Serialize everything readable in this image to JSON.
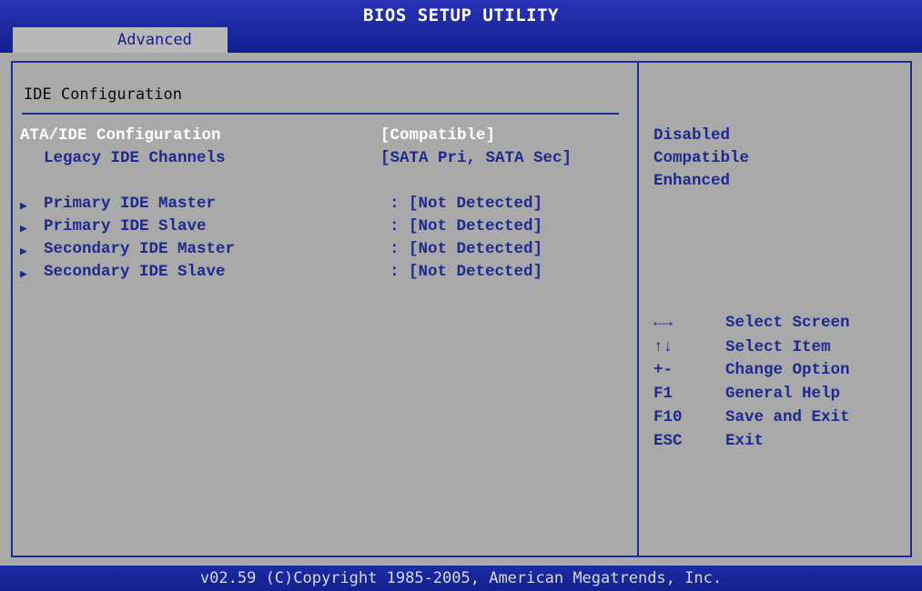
{
  "header": {
    "title": "BIOS SETUP UTILITY",
    "tab": "Advanced"
  },
  "section": {
    "title": "IDE Configuration"
  },
  "settings": [
    {
      "label": "ATA/IDE Configuration",
      "value": "[Compatible]",
      "selected": true
    },
    {
      "label": "Legacy IDE Channels",
      "value": "[SATA Pri, SATA Sec]"
    }
  ],
  "devices": [
    {
      "label": "Primary IDE Master",
      "value": ": [Not Detected]"
    },
    {
      "label": "Primary IDE Slave",
      "value": ": [Not Detected]"
    },
    {
      "label": "Secondary IDE Master",
      "value": ": [Not Detected]"
    },
    {
      "label": "Secondary IDE Slave",
      "value": ": [Not Detected]"
    }
  ],
  "submenu_arrow": "▶",
  "options": [
    "Disabled",
    "Compatible",
    "Enhanced"
  ],
  "help": [
    {
      "key": "←→",
      "desc": "Select Screen"
    },
    {
      "key": "↑↓",
      "desc": "Select Item"
    },
    {
      "key": "+-",
      "desc": "Change Option"
    },
    {
      "key": "F1",
      "desc": "General Help"
    },
    {
      "key": "F10",
      "desc": "Save and Exit"
    },
    {
      "key": "ESC",
      "desc": "Exit"
    }
  ],
  "footer": {
    "copyright": "v02.59 (C)Copyright 1985-2005, American Megatrends, Inc."
  },
  "colors": {
    "bar": "#1a28a0",
    "background": "#a9a9a9",
    "text": "#1f2a8e",
    "selected": "#ffffff"
  }
}
